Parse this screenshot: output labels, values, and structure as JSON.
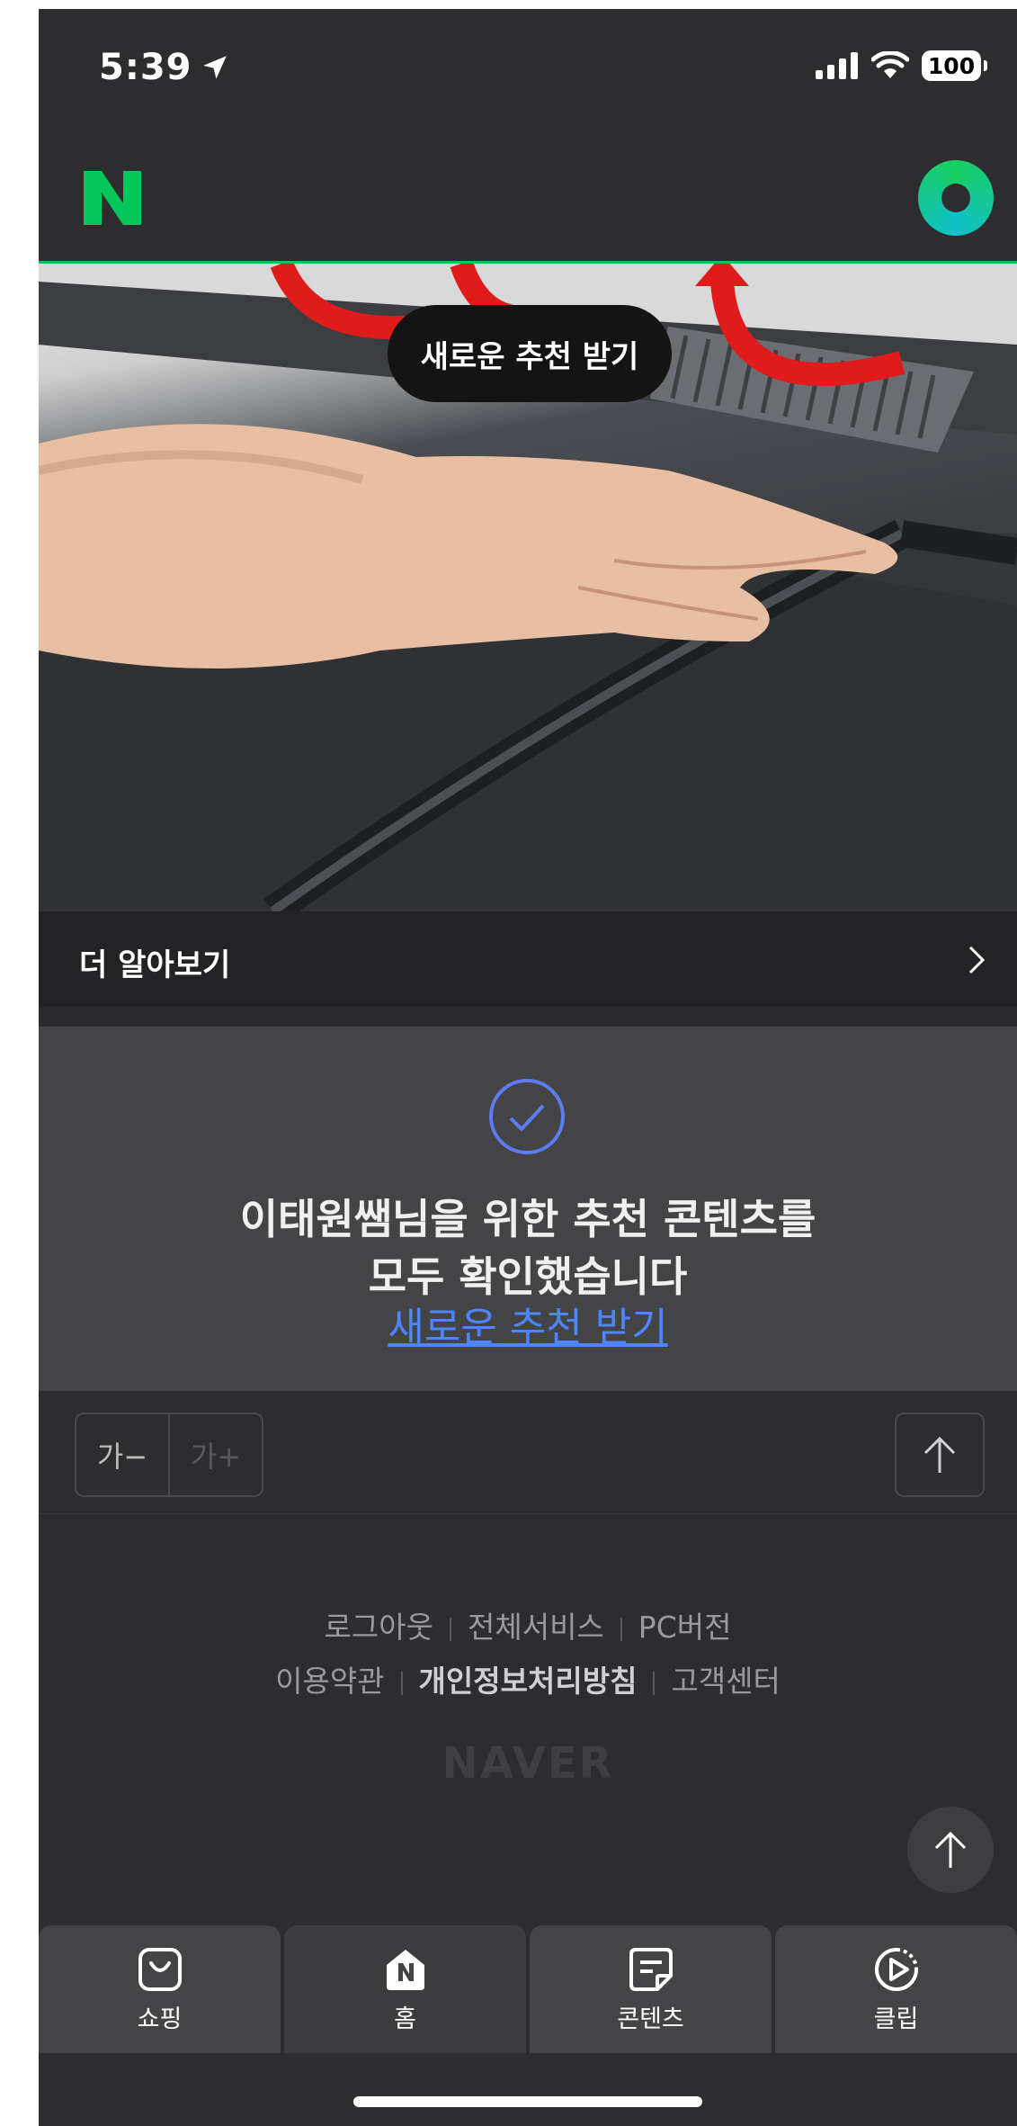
{
  "status_bar": {
    "time": "5:39",
    "battery": "100"
  },
  "header": {
    "logo": "N",
    "green_button_icon": "naver-green-dot-icon"
  },
  "hero": {
    "toast_label": "새로운 추천 받기"
  },
  "more": {
    "label": "더 알아보기"
  },
  "done": {
    "line1": "이태원쌤님을 위한 추천 콘텐츠를",
    "line2": "모두 확인했습니다",
    "link": "새로운 추천 받기"
  },
  "tools": {
    "font_minus": "가−",
    "font_plus": "가+"
  },
  "footer": {
    "row1": [
      "로그아웃",
      "전체서비스",
      "PC버전"
    ],
    "row2": [
      "이용약관",
      "개인정보처리방침",
      "고객센터"
    ],
    "brand": "NAVER"
  },
  "tabs": [
    {
      "label": "쇼핑",
      "icon": "shopping-bag-icon"
    },
    {
      "label": "홈",
      "icon": "home-icon"
    },
    {
      "label": "콘텐츠",
      "icon": "content-note-icon"
    },
    {
      "label": "클립",
      "icon": "clip-play-icon"
    }
  ],
  "colors": {
    "accent_green": "#03c75a",
    "link_blue": "#4d86ff",
    "background": "#2d2d30"
  }
}
